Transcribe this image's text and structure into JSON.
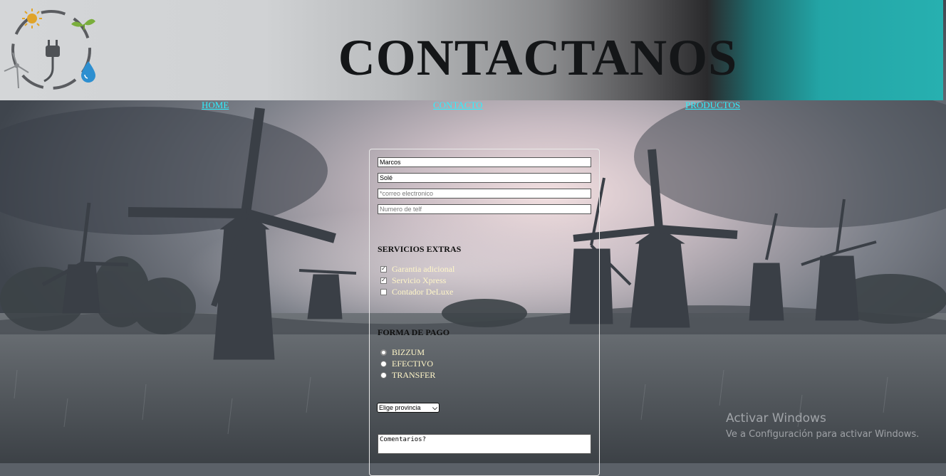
{
  "header": {
    "title": "CONTACTANOS"
  },
  "nav": {
    "home": "HOME",
    "contact": "CONTACTO",
    "products": "PRODUCTOS"
  },
  "form": {
    "first_name": {
      "value": "Marcos",
      "placeholder": ""
    },
    "last_name": {
      "value": "Solé",
      "placeholder": ""
    },
    "email": {
      "value": "",
      "placeholder": "*correo electronico"
    },
    "phone": {
      "value": "",
      "placeholder": "Numero de telf"
    },
    "extras": {
      "heading": "SERVICIOS EXTRAS",
      "options": [
        {
          "label": "Garantia adicional",
          "checked": true
        },
        {
          "label": "Servicio Xpress",
          "checked": true
        },
        {
          "label": "Contador DeLuxe",
          "checked": false
        }
      ]
    },
    "payment": {
      "heading": "FORMA DE PAGO",
      "options": [
        {
          "label": "BIZZUM",
          "selected": false
        },
        {
          "label": "EFECTIVO",
          "selected": false
        },
        {
          "label": "TRANSFER",
          "selected": false
        }
      ]
    },
    "province": {
      "selected": "Elige provincia"
    },
    "comments": {
      "value": "Comentarios?"
    }
  },
  "watermark": {
    "title": "Activar Windows",
    "subtitle": "Ve a Configuración para activar Windows."
  },
  "icons": [
    "sun-icon",
    "sprout-icon",
    "plug-icon",
    "wind-turbine-icon",
    "water-drop-icon",
    "chevron-down-icon",
    "check-icon"
  ],
  "colors": {
    "nav_link": "#2ef0ff",
    "option_label": "#fff6c8",
    "header_teal": "#27b0b0"
  }
}
